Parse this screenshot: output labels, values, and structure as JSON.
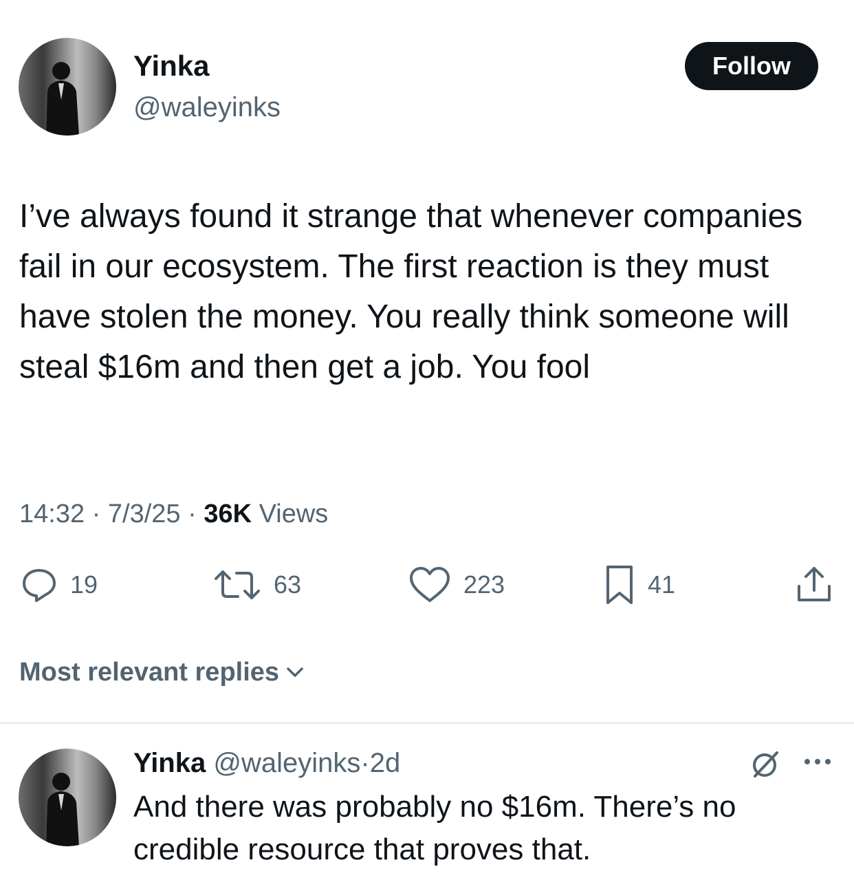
{
  "tweet": {
    "author": {
      "name": "Yinka",
      "handle": "@waleyinks",
      "avatar_icon": "profile-photo"
    },
    "follow_label": "Follow",
    "text": "I’ve always found it strange that whenever companies fail in our ecosystem. The first reaction is they must have stolen the money. You really think someone will steal $16m and then get a job. You fool",
    "time": "14:32",
    "date": "7/3/25",
    "separator": "·",
    "views_count": "36K",
    "views_label": "Views",
    "actions": {
      "replies": "19",
      "reposts": "63",
      "likes": "223",
      "bookmarks": "41"
    }
  },
  "replies_section": {
    "sort_label": "Most relevant replies"
  },
  "reply": {
    "name": "Yinka",
    "handle": "@waleyinks",
    "separator": "·",
    "age": "2d",
    "text": "And there was probably no $16m. There’s no credible resource that proves that."
  },
  "colors": {
    "text": "#0f1419",
    "secondary": "#536471",
    "button_bg": "#0f1419",
    "divider": "#e6e9ec"
  }
}
